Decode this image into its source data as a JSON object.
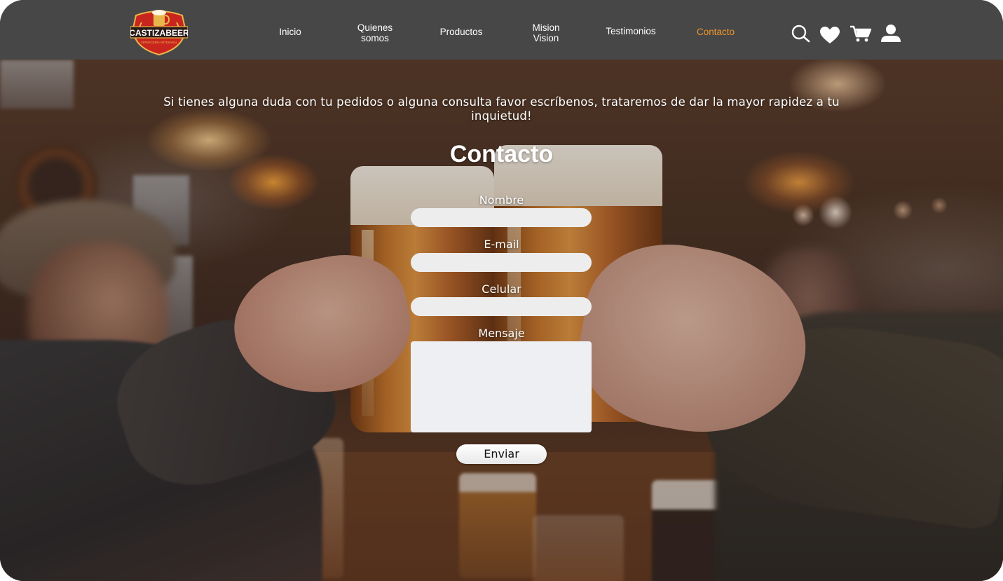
{
  "brand": {
    "name": "CASTIZABEER",
    "tagline": "CERVECERIA ARTESANAL"
  },
  "nav": {
    "items": [
      {
        "label": "Inicio"
      },
      {
        "label": "Quienes\nsomos"
      },
      {
        "label": "Productos"
      },
      {
        "label": "Mision\nVision"
      },
      {
        "label": "Testimonios"
      },
      {
        "label": "Contacto"
      }
    ],
    "active": "Contacto"
  },
  "header_icons": [
    "search-icon",
    "heart-icon",
    "cart-icon",
    "user-icon"
  ],
  "contact": {
    "intro": "Si tienes alguna duda con tu pedidos o alguna consulta favor escríbenos, trataremos de dar la mayor rapidez a tu inquietud!",
    "title": "Contacto",
    "fields": {
      "name_label": "Nombre",
      "email_label": "E-mail",
      "phone_label": "Celular",
      "message_label": "Mensaje"
    },
    "submit_label": "Enviar"
  },
  "colors": {
    "header_bg": "#474747",
    "active_nav": "#f0962a",
    "logo_red": "#c8251e",
    "logo_gold": "#e8b64a"
  }
}
